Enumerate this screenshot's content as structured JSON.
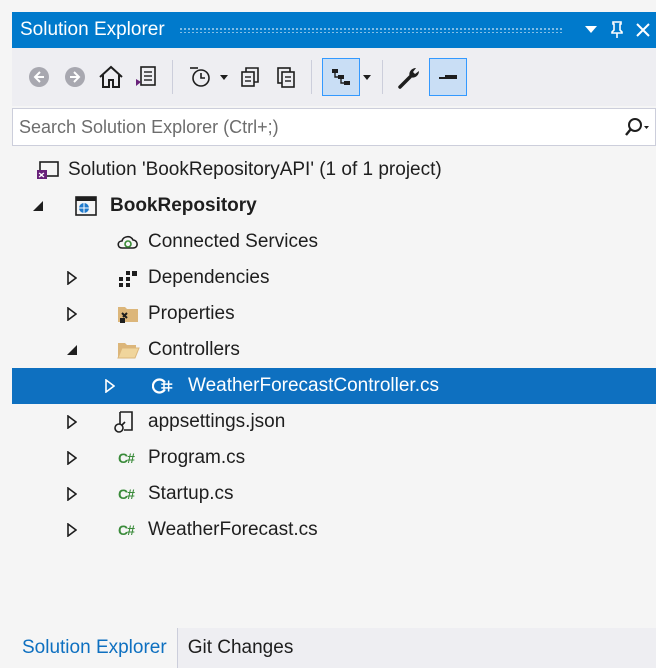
{
  "panel": {
    "title": "Solution Explorer",
    "buttons": {
      "dropdown_icon": "triangle-down-icon",
      "pin_icon": "pin-icon",
      "close_icon": "close-icon"
    }
  },
  "toolbar": {
    "items": [
      "back",
      "forward",
      "home",
      "switch-views",
      "pending-changes-filter",
      "sync-with-active-document",
      "refresh",
      "collapse-all",
      "show-all-files",
      "properties",
      "preview-selected-items"
    ]
  },
  "search": {
    "placeholder": "Search Solution Explorer (Ctrl+;)"
  },
  "tree": {
    "solution": {
      "label": "Solution 'BookRepositoryAPI' (1 of 1 project)"
    },
    "project": {
      "label": "BookRepository"
    },
    "items": [
      {
        "label": "Connected Services"
      },
      {
        "label": "Dependencies"
      },
      {
        "label": "Properties"
      },
      {
        "label": "Controllers"
      },
      {
        "label": "WeatherForecastController.cs"
      },
      {
        "label": "appsettings.json"
      },
      {
        "label": "Program.cs"
      },
      {
        "label": "Startup.cs"
      },
      {
        "label": "WeatherForecast.cs"
      }
    ],
    "cs_badge": "C#"
  },
  "tabs": [
    {
      "label": "Solution Explorer"
    },
    {
      "label": "Git Changes"
    }
  ],
  "colors": {
    "accent": "#007acc",
    "selection": "#0e70c0",
    "background": "#f5f5f5"
  }
}
